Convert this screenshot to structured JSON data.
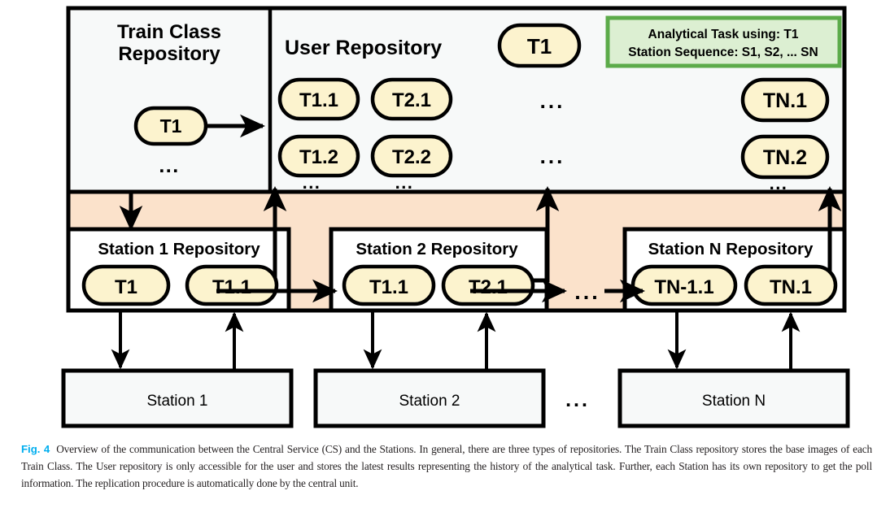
{
  "figure": {
    "panels": {
      "train_class_repo": {
        "title_line1": "Train Class",
        "title_line2": "Repository",
        "node": "T1",
        "ellipsis": "..."
      },
      "user_repo": {
        "title": "User Repository",
        "top_node": "T1",
        "col1": [
          "T1.1",
          "T1.2"
        ],
        "col2": [
          "T2.1",
          "T2.2"
        ],
        "coln": [
          "TN.1",
          "TN.2"
        ],
        "ellipsis_mid_row1": "...",
        "ellipsis_mid_row2": "...",
        "ellipsis_col1": "...",
        "ellipsis_col2": "...",
        "ellipsis_coln": "..."
      },
      "analytical_task": {
        "line1": "Analytical Task using: T1",
        "line2": "Station Sequence: S1, S2, ... SN"
      },
      "station_repos": [
        {
          "title": "Station 1 Repository",
          "nodes": [
            "T1",
            "T1.1"
          ]
        },
        {
          "title": "Station 2 Repository",
          "nodes": [
            "T1.1",
            "T2.1"
          ]
        },
        {
          "title": "Station N Repository",
          "nodes": [
            "TN-1.1",
            "TN.1"
          ]
        }
      ],
      "repo_chain_ellipsis": "...",
      "stations": [
        "Station 1",
        "Station 2",
        "Station N"
      ],
      "stations_ellipsis": "..."
    },
    "colors": {
      "node_fill": "#FCF3CE",
      "band_fill": "#FBE2CB",
      "panel_fill": "#F7F9F9",
      "task_fill": "#DCEFD2",
      "task_border": "#5CAB4A",
      "stroke": "#000000"
    }
  },
  "caption": {
    "label": "Fig. 4",
    "text": "Overview of the communication between the Central Service (CS) and the Stations. In general, there are three types of repositories. The Train Class repository stores the base images of each Train Class. The User repository is only accessible for the user and stores the latest results representing the history of the analytical task. Further, each Station has its own repository to get the poll information. The replication procedure is automatically done by the central unit."
  }
}
